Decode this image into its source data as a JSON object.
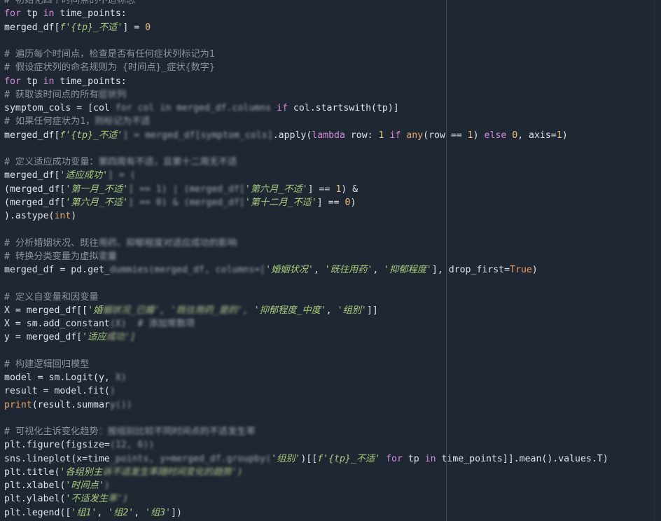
{
  "colors": {
    "background": "#1f2733",
    "text": "#dfe3ea",
    "comment": "#8b939f",
    "keyword": "#d38bd8",
    "string": "#a9cb7a",
    "number": "#e7c27a",
    "builtin": "#e6a86c"
  },
  "lines": [
    [
      {
        "t": "# 初始化四个时间点的不适标志",
        "c": "comment"
      }
    ],
    [
      {
        "t": "for",
        "c": "kw"
      },
      {
        "t": " tp "
      },
      {
        "t": "in",
        "c": "kw"
      },
      {
        "t": " time_points:"
      }
    ],
    [
      {
        "t": "merged_df["
      },
      {
        "t": "f'{tp}_不适'",
        "c": "str"
      },
      {
        "t": "] = "
      },
      {
        "t": "0",
        "c": "num"
      }
    ],
    [],
    [
      {
        "t": "# 遍历每个时间点，检查是否有任何症状列标记为1",
        "c": "comment"
      }
    ],
    [
      {
        "t": "# 假设症状列的命名规则为 {时间点}_症状{数字}",
        "c": "comment"
      }
    ],
    [
      {
        "t": "for",
        "c": "kw"
      },
      {
        "t": " tp "
      },
      {
        "t": "in",
        "c": "kw"
      },
      {
        "t": " time_points:"
      }
    ],
    [
      {
        "t": "# 获取该时间点的所有",
        "c": "comment"
      },
      {
        "t": "症状列",
        "c": "blur"
      }
    ],
    [
      {
        "t": "symptom_cols = [col"
      },
      {
        "t": " for col in merged_df.columns",
        "c": "blur"
      },
      {
        "t": " "
      },
      {
        "t": "if",
        "c": "kw"
      },
      {
        "t": " col.startswith(tp)]"
      }
    ],
    [
      {
        "t": "# 如果任何症状为1，",
        "c": "comment"
      },
      {
        "t": "则标记为不适",
        "c": "blur"
      }
    ],
    [
      {
        "t": "merged_df["
      },
      {
        "t": "f'{tp}_不适'",
        "c": "str"
      },
      {
        "t": "] = merged_df[symptom_cols]",
        "c": "blur"
      },
      {
        "t": ".apply("
      },
      {
        "t": "lambda",
        "c": "kw"
      },
      {
        "t": " row: "
      },
      {
        "t": "1",
        "c": "num"
      },
      {
        "t": " "
      },
      {
        "t": "if",
        "c": "kw"
      },
      {
        "t": " "
      },
      {
        "t": "any",
        "c": "builtin"
      },
      {
        "t": "(row == "
      },
      {
        "t": "1",
        "c": "num"
      },
      {
        "t": ") "
      },
      {
        "t": "else",
        "c": "kw"
      },
      {
        "t": " "
      },
      {
        "t": "0",
        "c": "num"
      },
      {
        "t": ", axis="
      },
      {
        "t": "1",
        "c": "num"
      },
      {
        "t": ")"
      }
    ],
    [],
    [
      {
        "t": "# 定义适应成功变量：",
        "c": "comment"
      },
      {
        "t": "第四周有不适，且第十二周无不适",
        "c": "blur"
      }
    ],
    [
      {
        "t": "merged_df["
      },
      {
        "t": "'适应成功'",
        "c": "str"
      },
      {
        "t": "] = (",
        "c": "blur"
      }
    ],
    [
      {
        "t": "(merged_df["
      },
      {
        "t": "'第一月_不适'",
        "c": "str"
      },
      {
        "t": "] == 1) | (merged_df[",
        "c": "blur"
      },
      {
        "t": "'第六月_不适'",
        "c": "str"
      },
      {
        "t": "] == "
      },
      {
        "t": "1",
        "c": "num"
      },
      {
        "t": ") &"
      }
    ],
    [
      {
        "t": "(merged_df["
      },
      {
        "t": "'第六月_不适'",
        "c": "str"
      },
      {
        "t": "] == 0) & (merged_df[",
        "c": "blur"
      },
      {
        "t": "'第十二月_不适'",
        "c": "str"
      },
      {
        "t": "] == "
      },
      {
        "t": "0",
        "c": "num"
      },
      {
        "t": ")"
      }
    ],
    [
      {
        "t": ").astype("
      },
      {
        "t": "int",
        "c": "builtin"
      },
      {
        "t": ")"
      }
    ],
    [],
    [
      {
        "t": "# 分析婚姻状况、既往",
        "c": "comment"
      },
      {
        "t": "用药、抑郁程度对适应成功的影响",
        "c": "blur"
      }
    ],
    [
      {
        "t": "# 转换分类变量为虚拟",
        "c": "comment"
      },
      {
        "t": "变量",
        "c": "blur"
      }
    ],
    [
      {
        "t": "merged_df = pd.get_"
      },
      {
        "t": "dummies(merged_df, columns=[",
        "c": "blur"
      },
      {
        "t": "'婚姻状况'",
        "c": "str"
      },
      {
        "t": ", "
      },
      {
        "t": "'既往用药'",
        "c": "str"
      },
      {
        "t": ", "
      },
      {
        "t": "'抑郁程度'",
        "c": "str"
      },
      {
        "t": "], drop_first="
      },
      {
        "t": "True",
        "c": "bool"
      },
      {
        "t": ")"
      }
    ],
    [],
    [
      {
        "t": "# 定义自变量和因变量",
        "c": "comment"
      }
    ],
    [
      {
        "t": "X = merged_df[["
      },
      {
        "t": "'婚",
        "c": "str"
      },
      {
        "t": "姻状况_已婚', '既往用药_是的',",
        "c": "blur-str"
      },
      {
        "t": " "
      },
      {
        "t": "'抑郁程度_中度'",
        "c": "str"
      },
      {
        "t": ", "
      },
      {
        "t": "'组别'",
        "c": "str"
      },
      {
        "t": "]]"
      }
    ],
    [
      {
        "t": "X = sm.add_constant"
      },
      {
        "t": "(X)  # 添加常数项",
        "c": "blur"
      }
    ],
    [
      {
        "t": "y = merged_df["
      },
      {
        "t": "'适应",
        "c": "str"
      },
      {
        "t": "成功']",
        "c": "blur-str"
      }
    ],
    [],
    [
      {
        "t": "# 构建逻辑回归模型",
        "c": "comment"
      }
    ],
    [
      {
        "t": "model = sm.Logit(y, "
      },
      {
        "t": "X)",
        "c": "blur"
      }
    ],
    [
      {
        "t": "result = model.fit("
      },
      {
        "t": ")",
        "c": "blur"
      }
    ],
    [
      {
        "t": "print",
        "c": "builtin"
      },
      {
        "t": "(result.summar"
      },
      {
        "t": "y())",
        "c": "blur"
      }
    ],
    [],
    [
      {
        "t": "# 可视化主诉变化趋势",
        "c": "comment"
      },
      {
        "t": "：按组别比较不同时间点的不适发生率",
        "c": "blur"
      }
    ],
    [
      {
        "t": "plt.figure(figsize="
      },
      {
        "t": "(12, 6))",
        "c": "blur"
      }
    ],
    [
      {
        "t": "sns.lineplot(x=time"
      },
      {
        "t": "_points, y=merged_df.groupby(",
        "c": "blur"
      },
      {
        "t": "'组别'",
        "c": "str"
      },
      {
        "t": ")[["
      },
      {
        "t": "f'{tp}_不适'",
        "c": "str"
      },
      {
        "t": " "
      },
      {
        "t": "for",
        "c": "kw"
      },
      {
        "t": " tp "
      },
      {
        "t": "in",
        "c": "kw"
      },
      {
        "t": " time_points]].mean().values.T)"
      }
    ],
    [
      {
        "t": "plt.title("
      },
      {
        "t": "'各组别主",
        "c": "str"
      },
      {
        "t": "诉不适发生率随时间变化的趋势')",
        "c": "blur-str"
      }
    ],
    [
      {
        "t": "plt.xlabel("
      },
      {
        "t": "'时间点'",
        "c": "str"
      },
      {
        "t": ")",
        "c": "blur"
      }
    ],
    [
      {
        "t": "plt.ylabel("
      },
      {
        "t": "'不适发生",
        "c": "str"
      },
      {
        "t": "率')",
        "c": "blur-str"
      }
    ],
    [
      {
        "t": "plt.legend(["
      },
      {
        "t": "'组1'",
        "c": "str"
      },
      {
        "t": ", "
      },
      {
        "t": "'组2'",
        "c": "str"
      },
      {
        "t": ", "
      },
      {
        "t": "'组3'",
        "c": "str"
      },
      {
        "t": "])"
      }
    ]
  ]
}
